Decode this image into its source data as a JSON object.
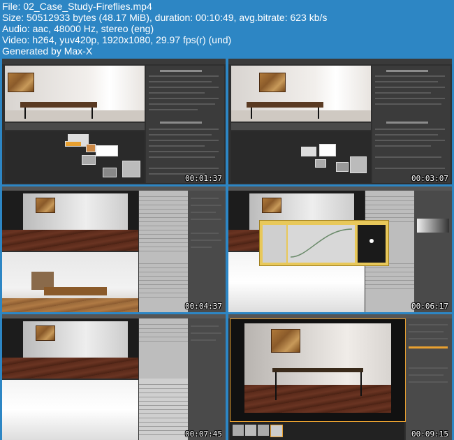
{
  "header": {
    "lines": [
      "File: 02_Case_Study-Fireflies.mp4",
      "Size: 50512933 bytes (48.17 MiB), duration: 00:10:49, avg.bitrate: 623 kb/s",
      "Audio: aac, 48000 Hz, stereo (eng)",
      "Video: h264, yuv420p, 1920x1080, 29.97 fps(r) (und)",
      "Generated by Max-X"
    ]
  },
  "thumbnails": [
    {
      "timestamp": "00:01:37"
    },
    {
      "timestamp": "00:03:07"
    },
    {
      "timestamp": "00:04:37"
    },
    {
      "timestamp": "00:06:17"
    },
    {
      "timestamp": "00:07:45"
    },
    {
      "timestamp": "00:09:15"
    }
  ],
  "colors": {
    "background": "#2d86c4",
    "ui_dark": "#2f2f2f",
    "accent_orange": "#e8a030",
    "graph_window": "#e8c85a"
  }
}
